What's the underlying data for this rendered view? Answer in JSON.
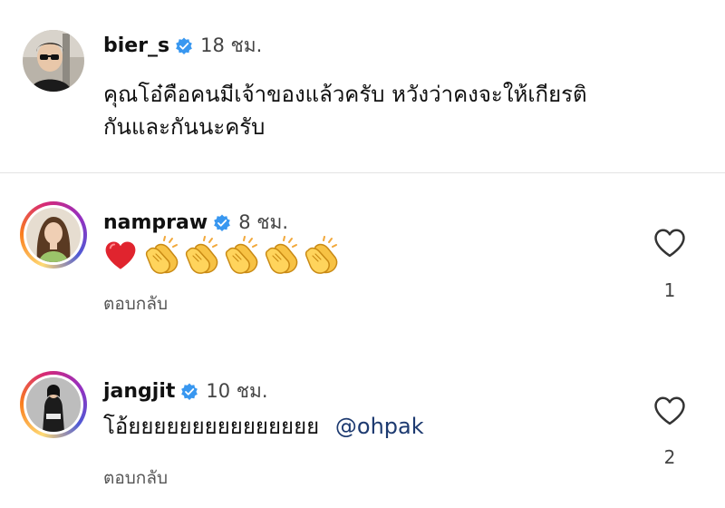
{
  "comments": [
    {
      "username": "bier_s",
      "time": "18 ชม.",
      "text_line1": "คุณโอ๋คือคนมีเจ้าของแล้วครับ หวังว่าคงจะให้เกียรติ",
      "text_line2": "กันและกันนะครับ"
    },
    {
      "username": "nampraw",
      "time": "8 ชม.",
      "emojis": [
        "red-heart",
        "clapping-hands",
        "clapping-hands",
        "clapping-hands",
        "clapping-hands",
        "clapping-hands"
      ],
      "reply_label": "ตอบกลับ",
      "like_count": "1"
    },
    {
      "username": "jangjit",
      "time": "10 ชม.",
      "text": "โอ้ยยยยยยยยยยยยยยย",
      "mention": "@ohpak",
      "reply_label": "ตอบกลับ",
      "like_count": "2"
    }
  ],
  "icons": {
    "verified": "verified-badge-icon",
    "like": "heart-outline-icon"
  },
  "colors": {
    "verified_blue": "#3897f0",
    "mention": "#1d3a70",
    "divider": "#e3e3e3"
  }
}
